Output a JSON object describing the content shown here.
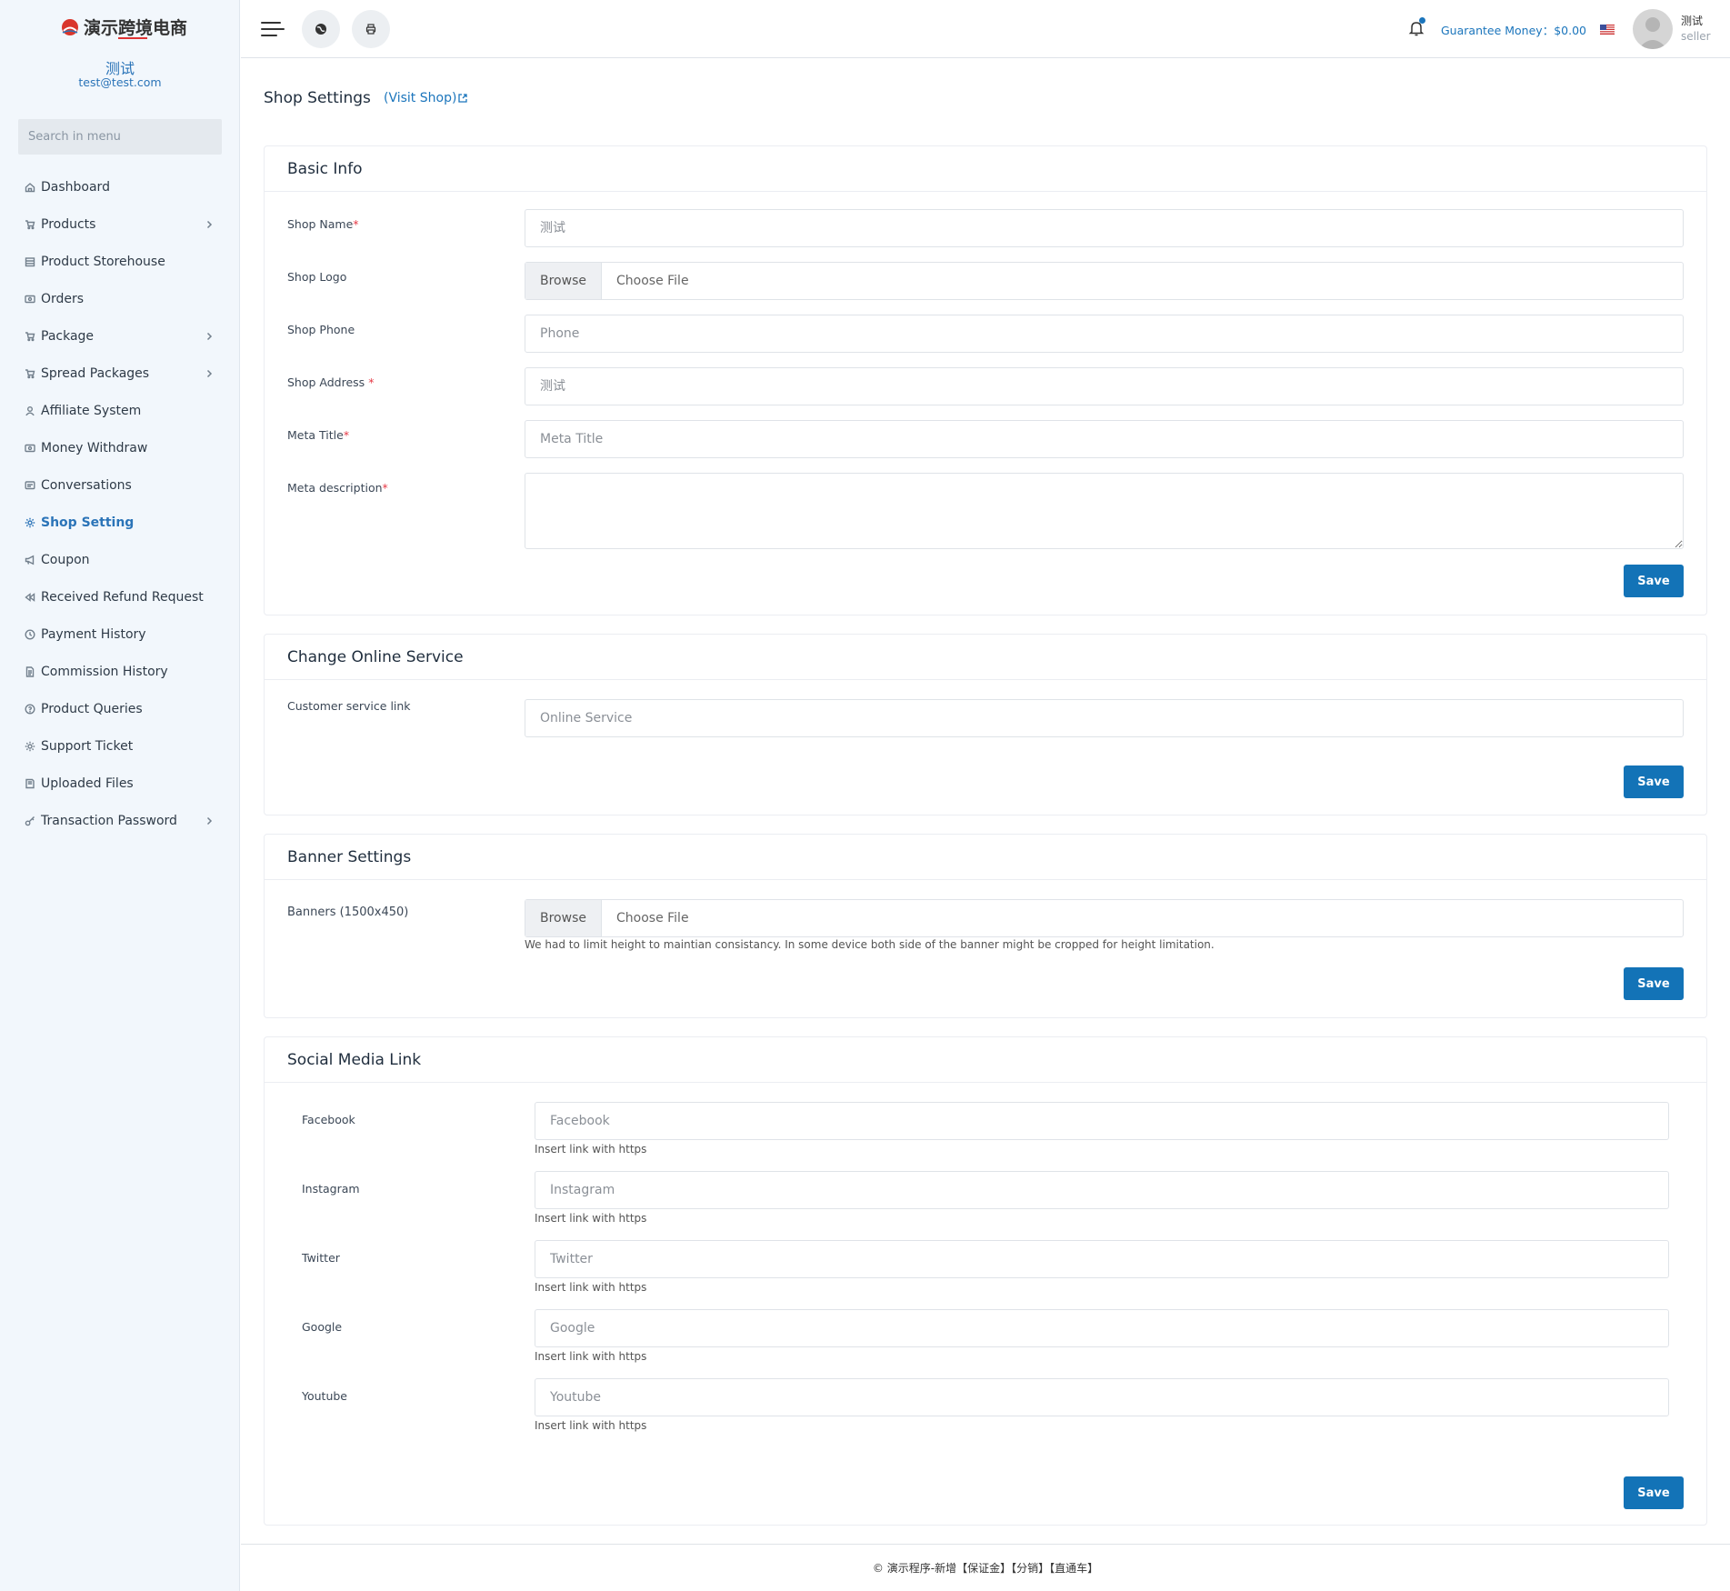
{
  "brand": {
    "name": "演示跨境电商"
  },
  "user": {
    "name": "测试",
    "email": "test@test.com",
    "role": "seller"
  },
  "sidebar": {
    "search_placeholder": "Search in menu",
    "items": [
      {
        "label": "Dashboard",
        "icon": "home-icon",
        "has_children": false,
        "active": false
      },
      {
        "label": "Products",
        "icon": "cart-icon",
        "has_children": true,
        "active": false
      },
      {
        "label": "Product Storehouse",
        "icon": "storehouse-icon",
        "has_children": false,
        "active": false
      },
      {
        "label": "Orders",
        "icon": "money-icon",
        "has_children": false,
        "active": false
      },
      {
        "label": "Package",
        "icon": "cart-icon",
        "has_children": true,
        "active": false
      },
      {
        "label": "Spread Packages",
        "icon": "cart-icon",
        "has_children": true,
        "active": false
      },
      {
        "label": "Affiliate System",
        "icon": "user-icon",
        "has_children": false,
        "active": false
      },
      {
        "label": "Money Withdraw",
        "icon": "money-icon",
        "has_children": false,
        "active": false
      },
      {
        "label": "Conversations",
        "icon": "chat-icon",
        "has_children": false,
        "active": false
      },
      {
        "label": "Shop Setting",
        "icon": "gear-icon",
        "has_children": false,
        "active": true
      },
      {
        "label": "Coupon",
        "icon": "megaphone-icon",
        "has_children": false,
        "active": false
      },
      {
        "label": "Received Refund Request",
        "icon": "backward-icon",
        "has_children": false,
        "active": false
      },
      {
        "label": "Payment History",
        "icon": "history-icon",
        "has_children": false,
        "active": false
      },
      {
        "label": "Commission History",
        "icon": "file-icon",
        "has_children": false,
        "active": false
      },
      {
        "label": "Product Queries",
        "icon": "question-icon",
        "has_children": false,
        "active": false
      },
      {
        "label": "Support Ticket",
        "icon": "gear-icon",
        "has_children": false,
        "active": false
      },
      {
        "label": "Uploaded Files",
        "icon": "folder-icon",
        "has_children": false,
        "active": false
      },
      {
        "label": "Transaction Password",
        "icon": "key-icon",
        "has_children": true,
        "active": false
      }
    ]
  },
  "topbar": {
    "guarantee_label": "Guarantee Money：$0.00",
    "notification_dot": true,
    "language_flag": "us-flag-icon"
  },
  "page": {
    "title": "Shop Settings",
    "visit_shop": "(Visit Shop)"
  },
  "basic_info": {
    "title": "Basic Info",
    "shop_name_label": "Shop Name",
    "shop_name_value": "",
    "shop_name_placeholder": "测试",
    "shop_logo_label": "Shop Logo",
    "browse": "Browse",
    "choose_file": "Choose File",
    "shop_phone_label": "Shop Phone",
    "shop_phone_placeholder": "Phone",
    "shop_address_label": "Shop Address",
    "shop_address_placeholder": "测试",
    "meta_title_label": "Meta Title",
    "meta_title_placeholder": "Meta Title",
    "meta_description_label": "Meta description",
    "meta_description_value": "",
    "save": "Save"
  },
  "online_service": {
    "title": "Change Online Service",
    "label": "Customer service link",
    "placeholder": "Online Service",
    "save": "Save"
  },
  "banner": {
    "title": "Banner Settings",
    "label": "Banners (1500x450)",
    "browse": "Browse",
    "choose_file": "Choose File",
    "hint": "We had to limit height to maintian consistancy. In some device both side of the banner might be cropped for height limitation.",
    "save": "Save"
  },
  "social": {
    "title": "Social Media Link",
    "hint": "Insert link with https",
    "links": [
      {
        "label": "Facebook",
        "placeholder": "Facebook"
      },
      {
        "label": "Instagram",
        "placeholder": "Instagram"
      },
      {
        "label": "Twitter",
        "placeholder": "Twitter"
      },
      {
        "label": "Google",
        "placeholder": "Google"
      },
      {
        "label": "Youtube",
        "placeholder": "Youtube"
      }
    ],
    "save": "Save"
  },
  "footer": {
    "text": "© 演示程序-新增【保证金】【分销】【直通车】"
  },
  "colors": {
    "accent": "#1373b7",
    "link": "#1b75bc",
    "sidebar_bg": "#f2f7fc",
    "required": "#e63946"
  }
}
